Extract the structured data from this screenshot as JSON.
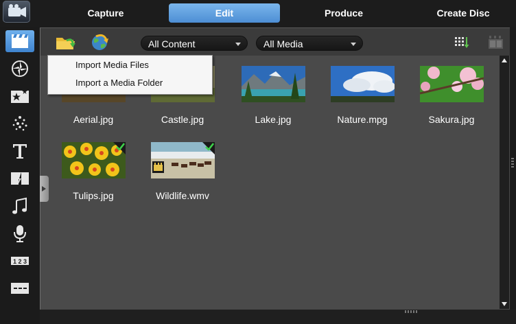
{
  "tabs": [
    {
      "label": "Capture"
    },
    {
      "label": "Edit"
    },
    {
      "label": "Produce"
    },
    {
      "label": "Create Disc"
    }
  ],
  "active_tab": "Edit",
  "sidebar": {
    "items": [
      {
        "icon": "media-room-icon",
        "active": true
      },
      {
        "icon": "fx-room-icon"
      },
      {
        "icon": "pip-objects-icon"
      },
      {
        "icon": "particle-room-icon"
      },
      {
        "icon": "title-room-icon"
      },
      {
        "icon": "transition-room-icon"
      },
      {
        "icon": "audio-mixing-icon"
      },
      {
        "icon": "voice-over-icon"
      },
      {
        "icon": "chapter-room-icon"
      },
      {
        "icon": "subtitle-room-icon"
      }
    ]
  },
  "toolbar": {
    "content_filter": "All Content",
    "media_filter": "All Media"
  },
  "context_menu": {
    "items": [
      "Import Media Files",
      "Import a Media Folder"
    ]
  },
  "media": [
    {
      "label": "Aerial.jpg",
      "checked": false
    },
    {
      "label": "Castle.jpg",
      "checked": false
    },
    {
      "label": "Lake.jpg",
      "checked": false
    },
    {
      "label": "Nature.mpg",
      "checked": false
    },
    {
      "label": "Sakura.jpg",
      "checked": false
    },
    {
      "label": "Tulips.jpg",
      "checked": true
    },
    {
      "label": "Wildlife.wmv",
      "checked": true
    }
  ],
  "colors": {
    "accent": "#5ea2e2",
    "panel": "#4a4a4a",
    "toolbar": "#3b3b3b"
  }
}
